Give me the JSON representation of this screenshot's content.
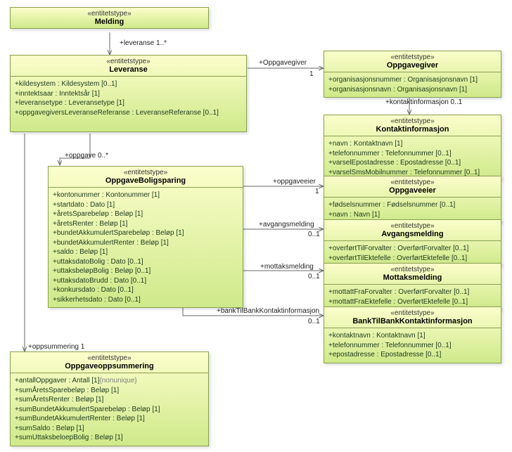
{
  "chart_data": {
    "type": "uml_class_diagram",
    "stereotype_label": "«entitetstype»",
    "entities": [
      {
        "id": "Melding",
        "name": "Melding",
        "attributes": []
      },
      {
        "id": "Leveranse",
        "name": "Leveranse",
        "attributes": [
          "kildesystem : Kildesystem [0..1]",
          "inntektsaar : Inntektsår [1]",
          "leveransetype : Leveransetype [1]",
          "oppgavegiversLeveranseReferanse : LeveranseReferanse [0..1]"
        ]
      },
      {
        "id": "OppgaveBoligsparing",
        "name": "OppgaveBoligsparing",
        "attributes": [
          "kontonummer : Kontonummer [1]",
          "startdato : Dato [1]",
          "åretsSparebeløp : Beløp [1]",
          "åretsRenter : Beløp [1]",
          "bundetAkkumulertSparebeløp : Beløp [1]",
          "bundetAkkumulertRenter : Beløp [1]",
          "saldo : Beløp [1]",
          "uttaksdatoBolig : Dato [0..1]",
          "uttaksbeløpBolig : Beløp [0..1]",
          "uttaksdatoBrudd : Dato [0..1]",
          "konkursdato : Dato [0..1]",
          "sikkerhetsdato : Dato [0..1]"
        ]
      },
      {
        "id": "Oppgaveoppsummering",
        "name": "Oppgaveoppsummering",
        "attributes_special": [
          {
            "text": "antallOppgaver : Antall [1]",
            "suffix": "{nonunique}"
          },
          {
            "text": "sumÅretsSparebeløp : Beløp [1]"
          },
          {
            "text": "sumÅretsRenter : Beløp [1]"
          },
          {
            "text": "sumBundetAkkumulertSparebeløp : Beløp [1]"
          },
          {
            "text": "sumBundetAkkumulertRenter : Beløp [1]"
          },
          {
            "text": "sumSaldo : Beløp [1]"
          },
          {
            "text": "sumUttaksbeloepBolig : Beløp [1]"
          }
        ]
      },
      {
        "id": "Oppgavegiver",
        "name": "Oppgavegiver",
        "attributes": [
          "organisasjonsnummer : Organisasjonsnavn [1]",
          "organisasjonsnavn : Organisasjonsnavn [1]"
        ]
      },
      {
        "id": "Kontaktinformasjon",
        "name": "Kontaktinformasjon",
        "attributes": [
          "navn : Kontaktnavn [1]",
          "telefonnummer : Telefonnummer [0..1]",
          "varselEpostadresse : Epostadresse [0..1]",
          "varselSmsMobilnummer : Telefonnummer [0..1]"
        ]
      },
      {
        "id": "Oppgaveeier",
        "name": "Oppgaveeier",
        "attributes": [
          "fødselsnummer : Fødselsnummer [0..1]",
          "navn : Navn [1]"
        ]
      },
      {
        "id": "Avgangsmelding",
        "name": "Avgangsmelding",
        "attributes": [
          "overførtTilForvalter : OverførtForvalter [0..1]",
          "overførtTilEktefelle : OverførtEktefelle [0..1]"
        ]
      },
      {
        "id": "Mottaksmelding",
        "name": "Mottaksmelding",
        "attributes": [
          "mottattFraForvalter : OverførtForvalter [0..1]",
          "mottattFraEktefelle : OverførtEktefelle [0..1]"
        ]
      },
      {
        "id": "BankTilBankKontaktinformasjon",
        "name": "BankTilBankKontaktinformasjon",
        "attributes": [
          "kontaktnavn : Kontaktnavn [1]",
          "telefonnummer : Telefonnummer [0..1]",
          "epostadresse : Epostadresse [0..1]"
        ]
      }
    ],
    "associations": [
      {
        "from": "Melding",
        "to": "Leveranse",
        "label": "+leveranse",
        "multiplicity": "1..*"
      },
      {
        "from": "Leveranse",
        "to": "Oppgavegiver",
        "label": "+Oppgavegiver",
        "multiplicity": "1"
      },
      {
        "from": "Oppgavegiver",
        "to": "Kontaktinformasjon",
        "label": "+kontaktinformasjon",
        "multiplicity": "0..1"
      },
      {
        "from": "Leveranse",
        "to": "OppgaveBoligsparing",
        "label": "+oppgave",
        "multiplicity": "0..*"
      },
      {
        "from": "Leveranse",
        "to": "Oppgaveoppsummering",
        "label": "+oppsummering",
        "multiplicity": "1"
      },
      {
        "from": "OppgaveBoligsparing",
        "to": "Oppgaveeier",
        "label": "+oppgaveeier",
        "multiplicity": "1"
      },
      {
        "from": "OppgaveBoligsparing",
        "to": "Avgangsmelding",
        "label": "+avgangsmelding",
        "multiplicity": "0..1"
      },
      {
        "from": "OppgaveBoligsparing",
        "to": "Mottaksmelding",
        "label": "+mottaksmelding",
        "multiplicity": "0..1"
      },
      {
        "from": "OppgaveBoligsparing",
        "to": "BankTilBankKontaktinformasjon",
        "label": "+bankTilBankKontaktinformasjon",
        "multiplicity": "0..1"
      }
    ]
  },
  "labels": {
    "leveranse": "+leveranse   1..*",
    "oppgavegiver": "+Oppgavegiver",
    "oppgavegiver_m": "1",
    "kontaktinfo": "+kontaktinformasjon   0..1",
    "oppgave": "+oppgave   0..*",
    "oppsummering": "+oppsummering   1",
    "oppgaveeier": "+oppgaveeier",
    "oppgaveeier_m": "1",
    "avgang": "+avgangsmelding",
    "avgang_m": "0..1",
    "mottak": "+mottaksmelding",
    "mottak_m": "0..1",
    "bankkontakt": "+bankTilBankKontaktinformasjon",
    "bankkontakt_m": "0..1"
  }
}
